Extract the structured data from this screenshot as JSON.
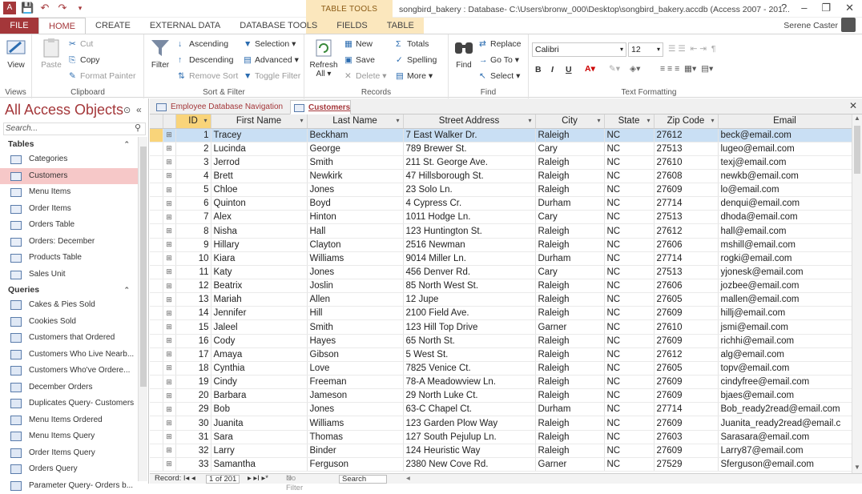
{
  "app": {
    "title": "songbird_bakery : Database- C:\\Users\\bronw_000\\Desktop\\songbird_bakery.accdb (Access 2007 - 201...",
    "contextual_label": "TABLE TOOLS",
    "user": "Serene Caster",
    "window_controls": [
      "?",
      "–",
      "❐",
      "✕"
    ]
  },
  "tabs": [
    "FILE",
    "HOME",
    "CREATE",
    "EXTERNAL DATA",
    "DATABASE TOOLS",
    "FIELDS",
    "TABLE"
  ],
  "ribbon": {
    "views": {
      "view": "View",
      "group": "Views"
    },
    "clipboard": {
      "paste": "Paste",
      "cut": "Cut",
      "copy": "Copy",
      "format_painter": "Format Painter",
      "group": "Clipboard"
    },
    "sort_filter": {
      "filter": "Filter",
      "ascending": "Ascending",
      "descending": "Descending",
      "remove_sort": "Remove Sort",
      "selection": "Selection ▾",
      "advanced": "Advanced ▾",
      "toggle_filter": "Toggle Filter",
      "group": "Sort & Filter"
    },
    "records": {
      "refresh": "Refresh",
      "refresh_all": "All ▾",
      "new": "New",
      "save": "Save",
      "delete": "Delete ▾",
      "totals": "Totals",
      "spelling": "Spelling",
      "more": "More ▾",
      "group": "Records"
    },
    "find": {
      "find": "Find",
      "replace": "Replace",
      "goto": "Go To ▾",
      "select": "Select ▾",
      "group": "Find"
    },
    "text_formatting": {
      "font": "Calibri",
      "size": "12",
      "bold": "B",
      "italic": "I",
      "underline": "U",
      "group": "Text Formatting"
    }
  },
  "nav": {
    "title": "All Access Objects",
    "search_placeholder": "Search...",
    "sections": [
      {
        "name": "Tables",
        "items": [
          "Categories",
          "Customers",
          "Menu Items",
          "Order Items",
          "Orders Table",
          "Orders: December",
          "Products Table",
          "Sales Unit"
        ]
      },
      {
        "name": "Queries",
        "items": [
          "Cakes & Pies Sold",
          "Cookies Sold",
          "Customers that Ordered",
          "Customers Who Live Nearb...",
          "Customers Who've Ordere...",
          "December Orders",
          "Duplicates Query- Customers",
          "Menu Items Ordered",
          "Menu Items Query",
          "Order Items Query",
          "Orders Query",
          "Parameter Query- Orders b..."
        ]
      }
    ],
    "selected": "Customers"
  },
  "object_tabs": [
    "Employee Database Navigation",
    "Customers"
  ],
  "columns": [
    "ID",
    "First Name",
    "Last Name",
    "Street Address",
    "City",
    "State",
    "Zip Code",
    "Email"
  ],
  "rows": [
    [
      "1",
      "Tracey",
      "Beckham",
      "7 East Walker Dr.",
      "Raleigh",
      "NC",
      "27612",
      "beck@email.com"
    ],
    [
      "2",
      "Lucinda",
      "George",
      "789 Brewer St.",
      "Cary",
      "NC",
      "27513",
      "lugeo@email.com"
    ],
    [
      "3",
      "Jerrod",
      "Smith",
      "211 St. George Ave.",
      "Raleigh",
      "NC",
      "27610",
      "texj@email.com"
    ],
    [
      "4",
      "Brett",
      "Newkirk",
      "47 Hillsborough St.",
      "Raleigh",
      "NC",
      "27608",
      "newkb@email.com"
    ],
    [
      "5",
      "Chloe",
      "Jones",
      "23 Solo Ln.",
      "Raleigh",
      "NC",
      "27609",
      "lo@email.com"
    ],
    [
      "6",
      "Quinton",
      "Boyd",
      "4 Cypress Cr.",
      "Durham",
      "NC",
      "27714",
      "denqui@email.com"
    ],
    [
      "7",
      "Alex",
      "Hinton",
      "1011 Hodge Ln.",
      "Cary",
      "NC",
      "27513",
      "dhoda@email.com"
    ],
    [
      "8",
      "Nisha",
      "Hall",
      "123 Huntington St.",
      "Raleigh",
      "NC",
      "27612",
      "hall@email.com"
    ],
    [
      "9",
      "Hillary",
      "Clayton",
      "2516 Newman",
      "Raleigh",
      "NC",
      "27606",
      "mshill@email.com"
    ],
    [
      "10",
      "Kiara",
      "Williams",
      "9014 Miller Ln.",
      "Durham",
      "NC",
      "27714",
      "rogki@email.com"
    ],
    [
      "11",
      "Katy",
      "Jones",
      "456 Denver Rd.",
      "Cary",
      "NC",
      "27513",
      "yjonesk@email.com"
    ],
    [
      "12",
      "Beatrix",
      "Joslin",
      "85 North West St.",
      "Raleigh",
      "NC",
      "27606",
      "jozbee@email.com"
    ],
    [
      "13",
      "Mariah",
      "Allen",
      "12 Jupe",
      "Raleigh",
      "NC",
      "27605",
      "mallen@email.com"
    ],
    [
      "14",
      "Jennifer",
      "Hill",
      "2100 Field Ave.",
      "Raleigh",
      "NC",
      "27609",
      "hillj@email.com"
    ],
    [
      "15",
      "Jaleel",
      "Smith",
      "123 Hill Top Drive",
      "Garner",
      "NC",
      "27610",
      "jsmi@email.com"
    ],
    [
      "16",
      "Cody",
      "Hayes",
      "65 North St.",
      "Raleigh",
      "NC",
      "27609",
      "richhi@email.com"
    ],
    [
      "17",
      "Amaya",
      "Gibson",
      "5 West St.",
      "Raleigh",
      "NC",
      "27612",
      "alg@email.com"
    ],
    [
      "18",
      "Cynthia",
      "Love",
      "7825 Venice Ct.",
      "Raleigh",
      "NC",
      "27605",
      "topv@email.com"
    ],
    [
      "19",
      "Cindy",
      "Freeman",
      "78-A Meadowview Ln.",
      "Raleigh",
      "NC",
      "27609",
      "cindyfree@email.com"
    ],
    [
      "20",
      "Barbara",
      "Jameson",
      "29 North Luke Ct.",
      "Raleigh",
      "NC",
      "27609",
      "bjaes@email.com"
    ],
    [
      "29",
      "Bob",
      "Jones",
      "63-C Chapel Ct.",
      "Durham",
      "NC",
      "27714",
      "Bob_ready2read@email.com"
    ],
    [
      "30",
      "Juanita",
      "Williams",
      "123 Garden Plow Way",
      "Raleigh",
      "NC",
      "27609",
      "Juanita_ready2read@email.c"
    ],
    [
      "31",
      "Sara",
      "Thomas",
      "127 South Pejulup Ln.",
      "Raleigh",
      "NC",
      "27603",
      "Sarasara@email.com"
    ],
    [
      "32",
      "Larry",
      "Binder",
      "124 Heuristic Way",
      "Raleigh",
      "NC",
      "27609",
      "Larry87@email.com"
    ],
    [
      "33",
      "Samantha",
      "Ferguson",
      "2380 New Cove Rd.",
      "Garner",
      "NC",
      "27529",
      "Sferguson@email.com"
    ]
  ],
  "record_bar": {
    "label": "Record: I◂ ◂",
    "position": "1 of 201",
    "next": "▸ ▸I ▸*",
    "filter": "No Filter",
    "search": "Search"
  },
  "colors": {
    "accent": "#a4373a",
    "selected_row": "#c9dff4",
    "current_cell": "#f9d47a"
  }
}
